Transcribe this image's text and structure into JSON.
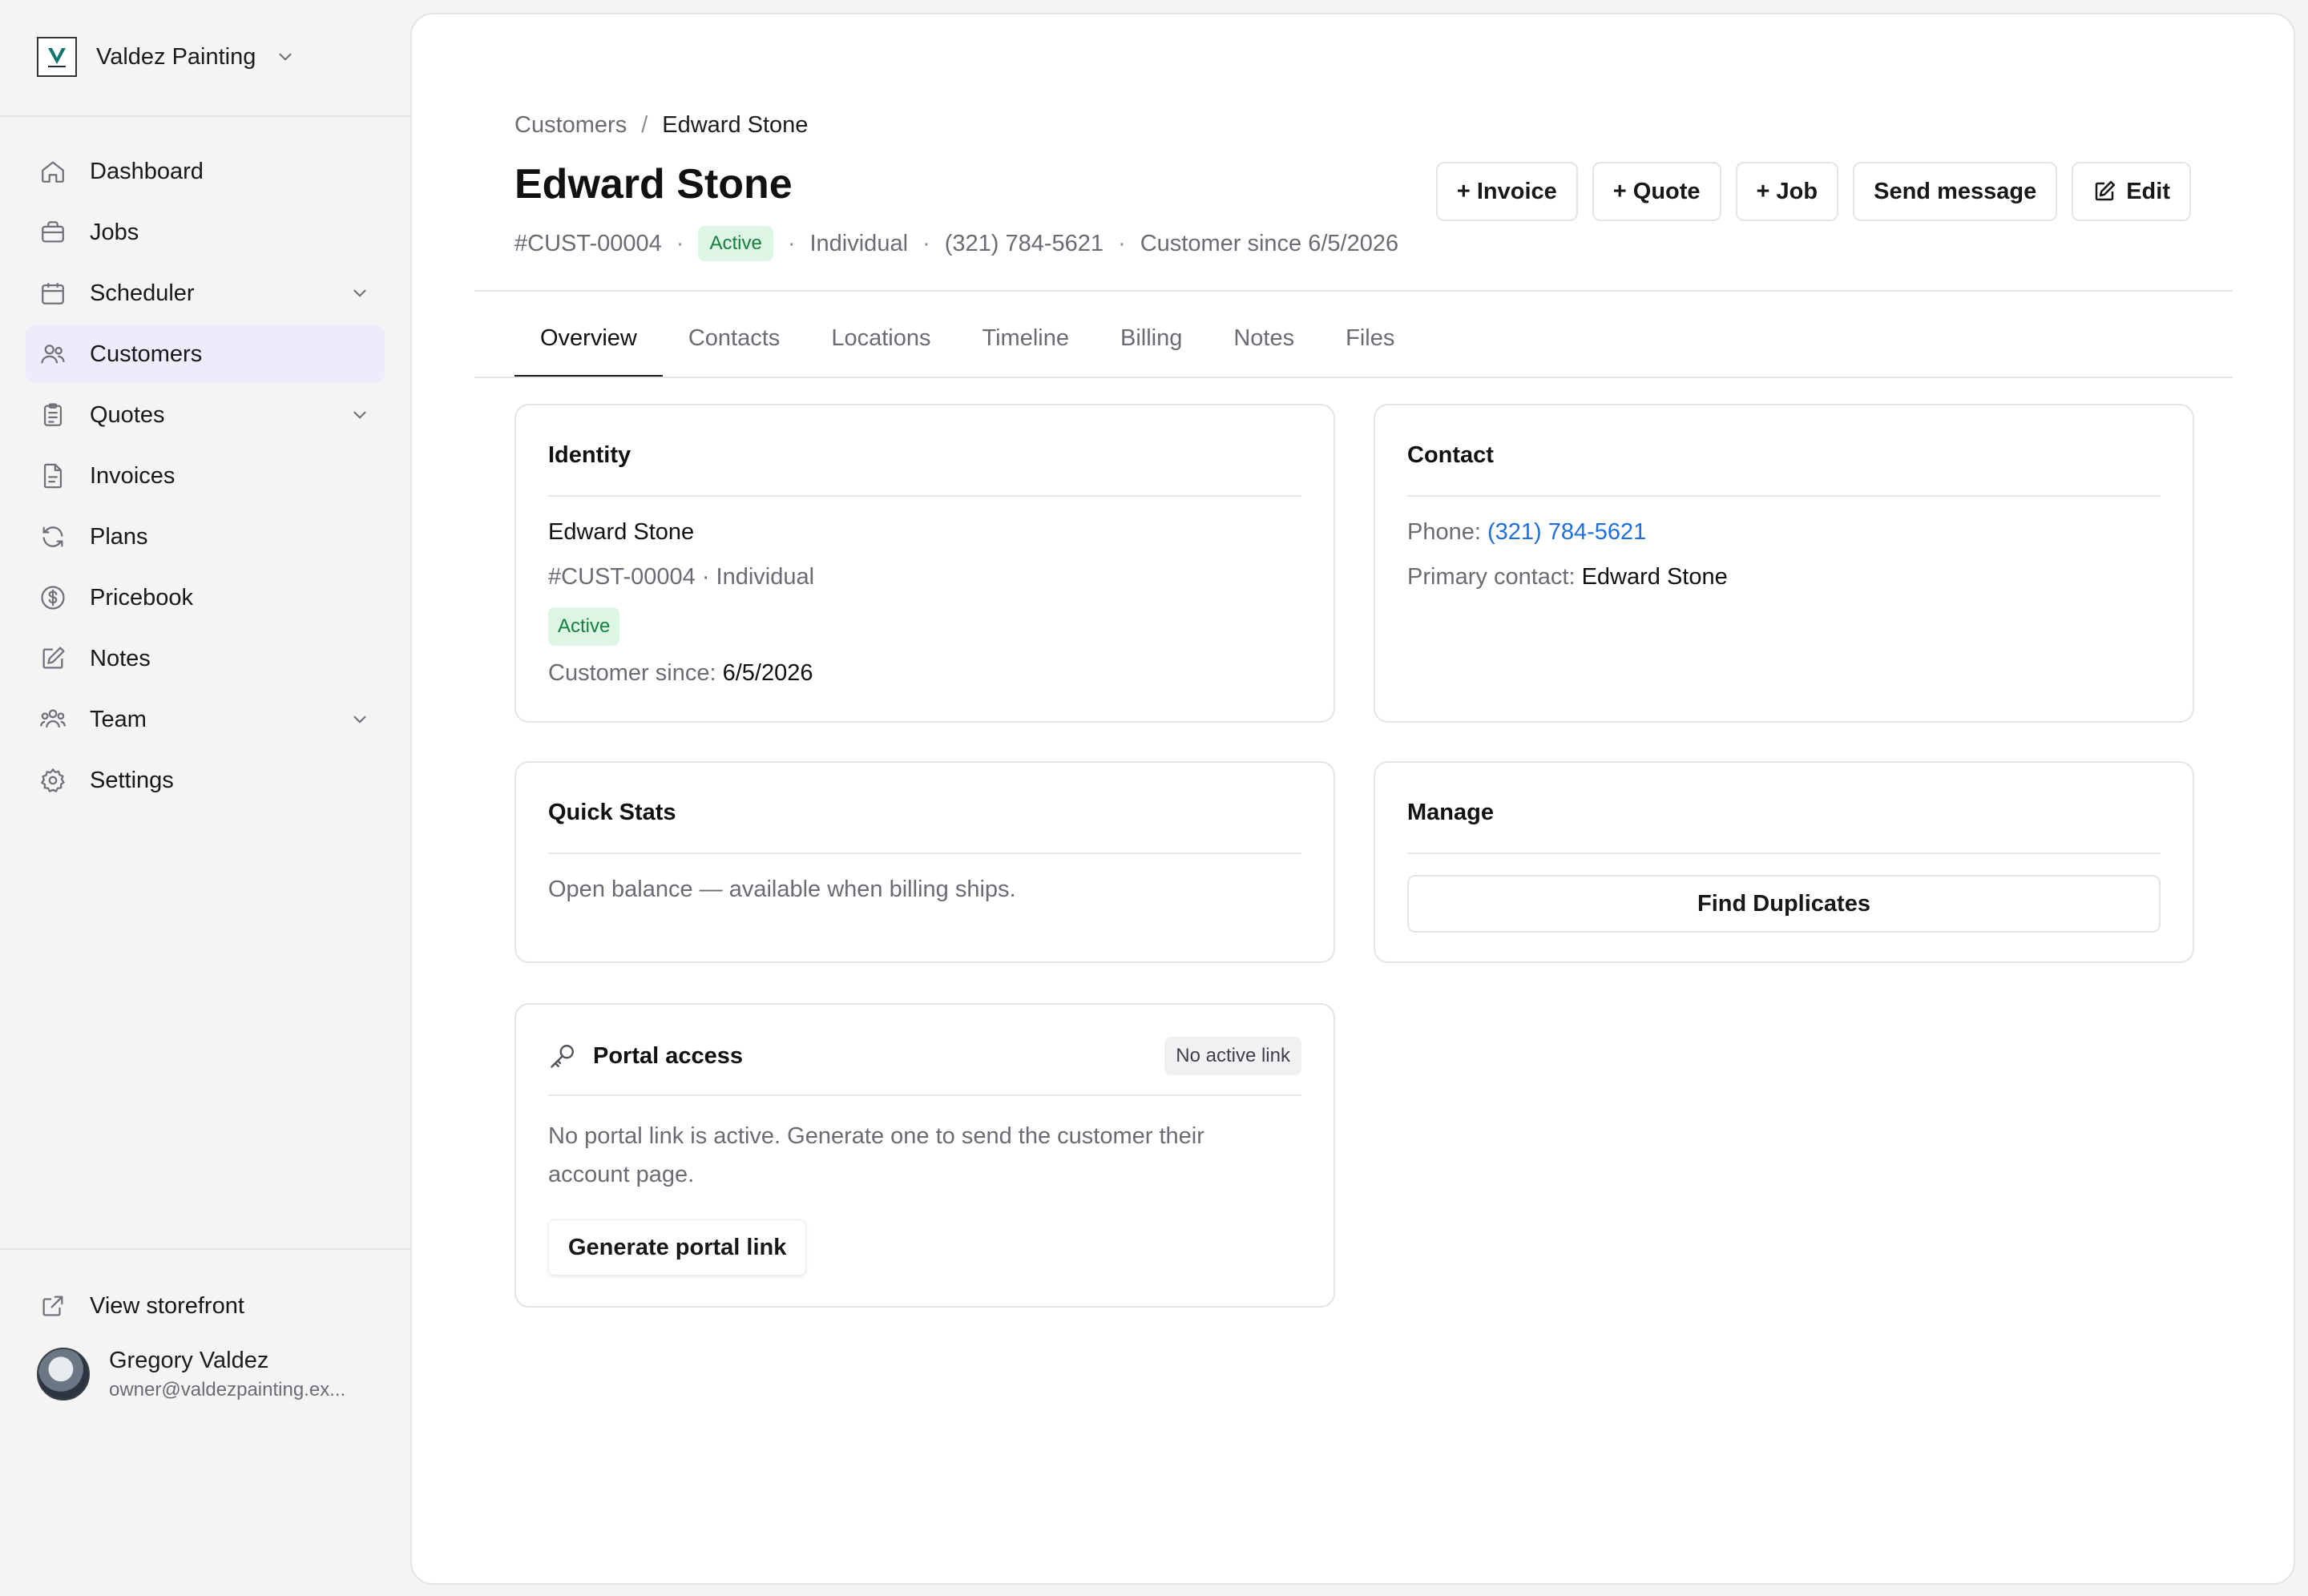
{
  "org": {
    "name": "Valdez Painting",
    "logo_text": "V"
  },
  "sidebar": {
    "items": [
      {
        "label": "Dashboard",
        "icon": "home-icon"
      },
      {
        "label": "Jobs",
        "icon": "briefcase-icon"
      },
      {
        "label": "Scheduler",
        "icon": "calendar-icon",
        "expandable": true
      },
      {
        "label": "Customers",
        "icon": "users-icon",
        "active": true
      },
      {
        "label": "Quotes",
        "icon": "clipboard-icon",
        "expandable": true
      },
      {
        "label": "Invoices",
        "icon": "file-icon"
      },
      {
        "label": "Plans",
        "icon": "refresh-icon"
      },
      {
        "label": "Pricebook",
        "icon": "dollar-icon"
      },
      {
        "label": "Notes",
        "icon": "pencil-icon"
      },
      {
        "label": "Team",
        "icon": "team-icon",
        "expandable": true
      },
      {
        "label": "Settings",
        "icon": "gear-icon"
      }
    ],
    "storefront_label": "View storefront"
  },
  "user": {
    "name": "Gregory Valdez",
    "email": "owner@valdezpainting.ex..."
  },
  "breadcrumb": {
    "parent": "Customers",
    "separator": "/",
    "current": "Edward Stone"
  },
  "customer": {
    "name": "Edward Stone",
    "id": "#CUST-00004",
    "status": "Active",
    "type": "Individual",
    "phone": "(321) 784-5621",
    "since_label": "Customer since 6/5/2026"
  },
  "actions": {
    "invoice": "+ Invoice",
    "quote": "+ Quote",
    "job": "+ Job",
    "message": "Send message",
    "edit": "Edit"
  },
  "tabs": [
    "Overview",
    "Contacts",
    "Locations",
    "Timeline",
    "Billing",
    "Notes",
    "Files"
  ],
  "identity": {
    "title": "Identity",
    "name": "Edward Stone",
    "id_type": "#CUST-00004 · Individual",
    "status": "Active",
    "since_label": "Customer since:",
    "since_value": "6/5/2026"
  },
  "contact": {
    "title": "Contact",
    "phone_label": "Phone:",
    "phone_value": "(321) 784-5621",
    "primary_label": "Primary contact:",
    "primary_value": "Edward Stone"
  },
  "quick_stats": {
    "title": "Quick Stats",
    "text": "Open balance — available when billing ships."
  },
  "manage": {
    "title": "Manage",
    "find_duplicates": "Find Duplicates"
  },
  "portal": {
    "title": "Portal access",
    "badge": "No active link",
    "text": "No portal link is active. Generate one to send the customer their account page.",
    "button": "Generate portal link"
  }
}
